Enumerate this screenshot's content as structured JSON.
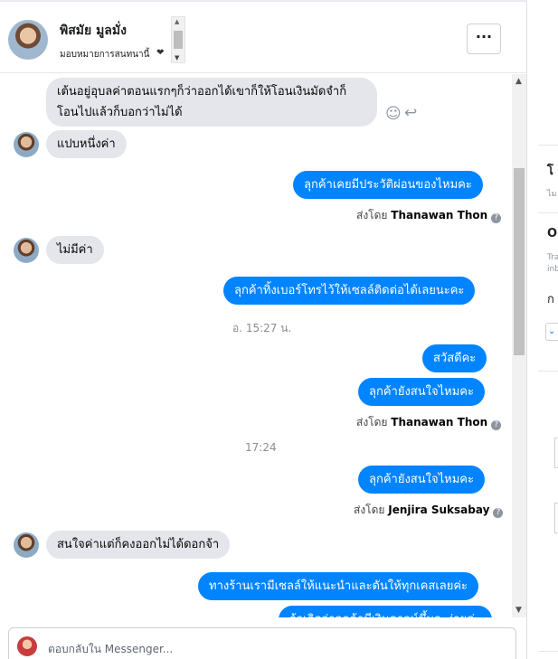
{
  "header": {
    "name": "พิสมัย มูลมั่ง",
    "subtitle": "มอบหมายการสนทนานี้",
    "heart": "❤",
    "more_label": "···"
  },
  "icons": {
    "scroll_up": "▲",
    "scroll_down": "▼",
    "smile": "☺",
    "reply": "↩",
    "chevron": "⌄"
  },
  "messages": {
    "m1_text": "เต้นอยู่อุบลค่าตอนแรกๆก็ว่าออกได้เขาก็ให้โอนเงินมัดจำก็โอนไปแล้วก็บอกว่าไม่ได้",
    "m2_text": "แปบหนึ่งค่า",
    "m3_text": "ลุกค้าเคยมีประวัติผ่อนของไหมคะ",
    "m3_sentby_prefix": "ส่งโดย",
    "m3_sender": "Thanawan Thon",
    "m4_text": "ไม่มีค่า",
    "m5_text": "ลุกค้าทิ้งเบอร์โทรไว้ให้เซลล์ติดต่อได้เลยนะคะ",
    "time1": "อ. 15:27 น.",
    "m6_text": "สวัสดีคะ",
    "m7_text": "ลุกค้ายังสนใจไหมคะ",
    "m7_sentby_prefix": "ส่งโดย",
    "m7_sender": "Thanawan Thon",
    "time2": "17:24",
    "m8_text": "ลุกค้ายังสนใจไหมคะ",
    "m8_sentby_prefix": "ส่งโดย",
    "m8_sender": "Jenjira Suksabay",
    "m9_text": "สนใจค่าแต่ก็คงออกไม่ได้ดอกจ้า",
    "m10_text": "ทางร้านเรามีเซลล์ให้แนะนำและดันให้ทุกเคสเลยค่ะ",
    "m11_text": "ถ้าเกิดว่าลูกค้ามีเงินดาวน์ขึ้นจะง่ายค่ะ",
    "info_glyph": "?"
  },
  "composer": {
    "placeholder": "ตอบกลับใน Messenger..."
  },
  "right_panel": {
    "t1": "โ",
    "t2": "ไม",
    "t3": "O",
    "t4": "Tra",
    "t5": "inb",
    "t6": "ก"
  },
  "colors": {
    "outgoing_bubble": "#0084ff",
    "incoming_bubble": "#e4e6eb"
  }
}
